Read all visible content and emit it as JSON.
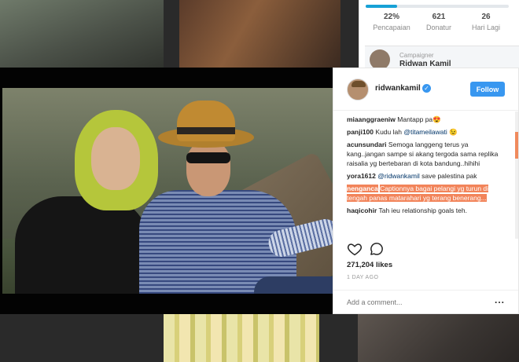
{
  "campaign": {
    "progress_pct": 22,
    "stats": [
      {
        "value": "22%",
        "label": "Pencapaian"
      },
      {
        "value": "621",
        "label": "Donatur"
      },
      {
        "value": "26",
        "label": "Hari Lagi"
      }
    ],
    "campaigner_tag": "Campaigner",
    "campaigner_name": "Ridwan Kamil"
  },
  "post": {
    "username": "ridwankamil",
    "verified": true,
    "follow_label": "Follow",
    "comments": [
      {
        "user": "miaanggraeniw",
        "text": "Mantapp pa😍"
      },
      {
        "user": "panji100",
        "text": "Kudu lah ",
        "mention": "@titameilawati",
        "after": " 😉"
      },
      {
        "user": "acunsundari",
        "text": "Semoga langgeng terus ya kang..jangan sampe si akang tergoda sama replika raisalia yg bertebaran di kota bandung..hihihi"
      },
      {
        "user": "yora1612",
        "mention": "@ridwankamil",
        "after": " save palestina pak"
      },
      {
        "user": "nenganca",
        "text": "Captionnya bagai pelangi yg turun di tengah panas matarahari yg terang benerang...",
        "highlighted": true
      },
      {
        "user": "haqicohir",
        "text": "Tah ieu relationship goals teh."
      }
    ],
    "likes": "271,204 likes",
    "time": "1 DAY AGO",
    "add_comment_placeholder": "Add a comment...",
    "more_label": "..."
  },
  "colors": {
    "follow": "#3897f0",
    "highlight": "#f2845a",
    "progress": "#17a1d6"
  }
}
